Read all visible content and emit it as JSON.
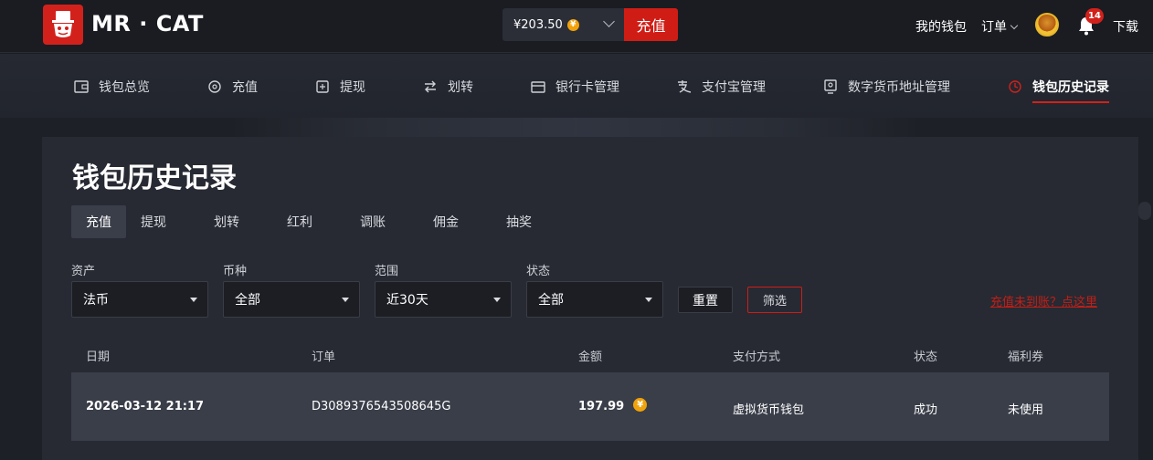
{
  "header": {
    "brand": "MR · CAT",
    "balance": "¥203.50",
    "balance_coin": "¥",
    "topup_label": "充值",
    "wallet_label": "我的钱包",
    "order_label": "订单",
    "notification_count": "14",
    "download_label": "下载",
    "colors": {
      "accent": "#d2211b",
      "coin": "#f1a20a"
    }
  },
  "subnav": {
    "items": [
      {
        "label": "钱包总览",
        "icon": "wallet-icon"
      },
      {
        "label": "充值",
        "icon": "topup-icon"
      },
      {
        "label": "提现",
        "icon": "withdraw-icon"
      },
      {
        "label": "划转",
        "icon": "transfer-icon"
      },
      {
        "label": "银行卡管理",
        "icon": "bank-card-icon"
      },
      {
        "label": "支付宝管理",
        "icon": "alipay-icon"
      },
      {
        "label": "数字货币地址管理",
        "icon": "crypto-address-icon"
      },
      {
        "label": "钱包历史记录",
        "icon": "history-clock-icon",
        "active": true
      }
    ]
  },
  "main": {
    "title": "钱包历史记录",
    "tabs": [
      {
        "label": "充值",
        "active": true
      },
      {
        "label": "提现"
      },
      {
        "label": "划转"
      },
      {
        "label": "红利"
      },
      {
        "label": "调账"
      },
      {
        "label": "佣金"
      },
      {
        "label": "抽奖"
      }
    ],
    "filters": [
      {
        "label": "资产",
        "value": "法币"
      },
      {
        "label": "币种",
        "value": "全部"
      },
      {
        "label": "范围",
        "value": "近30天"
      },
      {
        "label": "状态",
        "value": "全部"
      }
    ],
    "reset_label": "重置",
    "filter_label": "筛选",
    "help_link": "充值未到账？点这里",
    "table": {
      "headers": [
        "日期",
        "订单",
        "金额",
        "支付方式",
        "状态",
        "福利券"
      ],
      "rows": [
        {
          "date": "2026-03-12 21:17",
          "order": "D3089376543508645G",
          "amount": "197.99",
          "coin": "¥",
          "method": "虚拟货币钱包",
          "status": "成功",
          "coupon": "未使用"
        }
      ]
    }
  }
}
